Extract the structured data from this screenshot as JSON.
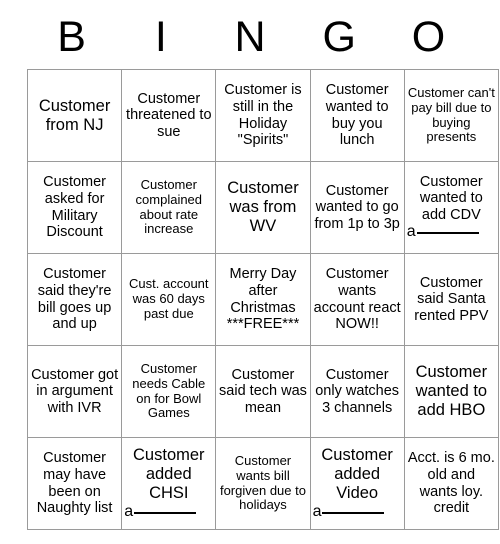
{
  "header": {
    "letters": [
      "B",
      "I",
      "N",
      "G",
      "O"
    ]
  },
  "grid": {
    "columns": 5,
    "rows": 5,
    "cells": [
      [
        {
          "text": "Customer from NJ",
          "size": "fs-lg",
          "blank": ""
        },
        {
          "text": "Customer threatened to sue",
          "size": "fs-md",
          "blank": ""
        },
        {
          "text": "Customer is still in the Holiday \"Spirits\"",
          "size": "fs-md",
          "blank": ""
        },
        {
          "text": "Customer wanted to buy you lunch",
          "size": "fs-md",
          "blank": ""
        },
        {
          "text": "Customer can't pay bill due to buying presents",
          "size": "fs-sm",
          "blank": ""
        }
      ],
      [
        {
          "text": "Customer asked for Military Discount",
          "size": "fs-md",
          "blank": ""
        },
        {
          "text": "Customer complained about rate increase",
          "size": "fs-sm",
          "blank": ""
        },
        {
          "text": "Customer was from WV",
          "size": "fs-lg",
          "blank": ""
        },
        {
          "text": "Customer wanted to go from 1p to 3p",
          "size": "fs-md",
          "blank": ""
        },
        {
          "text": "Customer wanted to add CDV",
          "size": "fs-md",
          "blank": "a"
        }
      ],
      [
        {
          "text": "Customer said they're bill goes up and up",
          "size": "fs-md",
          "blank": ""
        },
        {
          "text": "Cust. account was 60 days past due",
          "size": "fs-sm",
          "blank": ""
        },
        {
          "text": "Merry Day after Christmas ***FREE***",
          "size": "fs-md",
          "blank": ""
        },
        {
          "text": "Customer wants account react NOW!!",
          "size": "fs-md",
          "blank": ""
        },
        {
          "text": "Customer said Santa rented PPV",
          "size": "fs-md",
          "blank": ""
        }
      ],
      [
        {
          "text": "Customer got in argument with IVR",
          "size": "fs-md",
          "blank": ""
        },
        {
          "text": "Customer needs Cable on for Bowl Games",
          "size": "fs-sm",
          "blank": ""
        },
        {
          "text": "Customer said tech was mean",
          "size": "fs-md",
          "blank": ""
        },
        {
          "text": "Customer only watches 3 channels",
          "size": "fs-md",
          "blank": ""
        },
        {
          "text": "Customer wanted to add HBO",
          "size": "fs-lg",
          "blank": ""
        }
      ],
      [
        {
          "text": "Customer may have been on Naughty list",
          "size": "fs-md",
          "blank": ""
        },
        {
          "text": "Customer added CHSI",
          "size": "fs-lg",
          "blank": "a"
        },
        {
          "text": "Customer wants bill forgiven due to holidays",
          "size": "fs-sm",
          "blank": ""
        },
        {
          "text": "Customer added Video",
          "size": "fs-lg",
          "blank": "a"
        },
        {
          "text": "Acct. is 6 mo. old and wants loy. credit",
          "size": "fs-md",
          "blank": ""
        }
      ]
    ]
  },
  "colors": {
    "background": "#ffffff",
    "text": "#000000",
    "border": "#9a9a9a"
  }
}
